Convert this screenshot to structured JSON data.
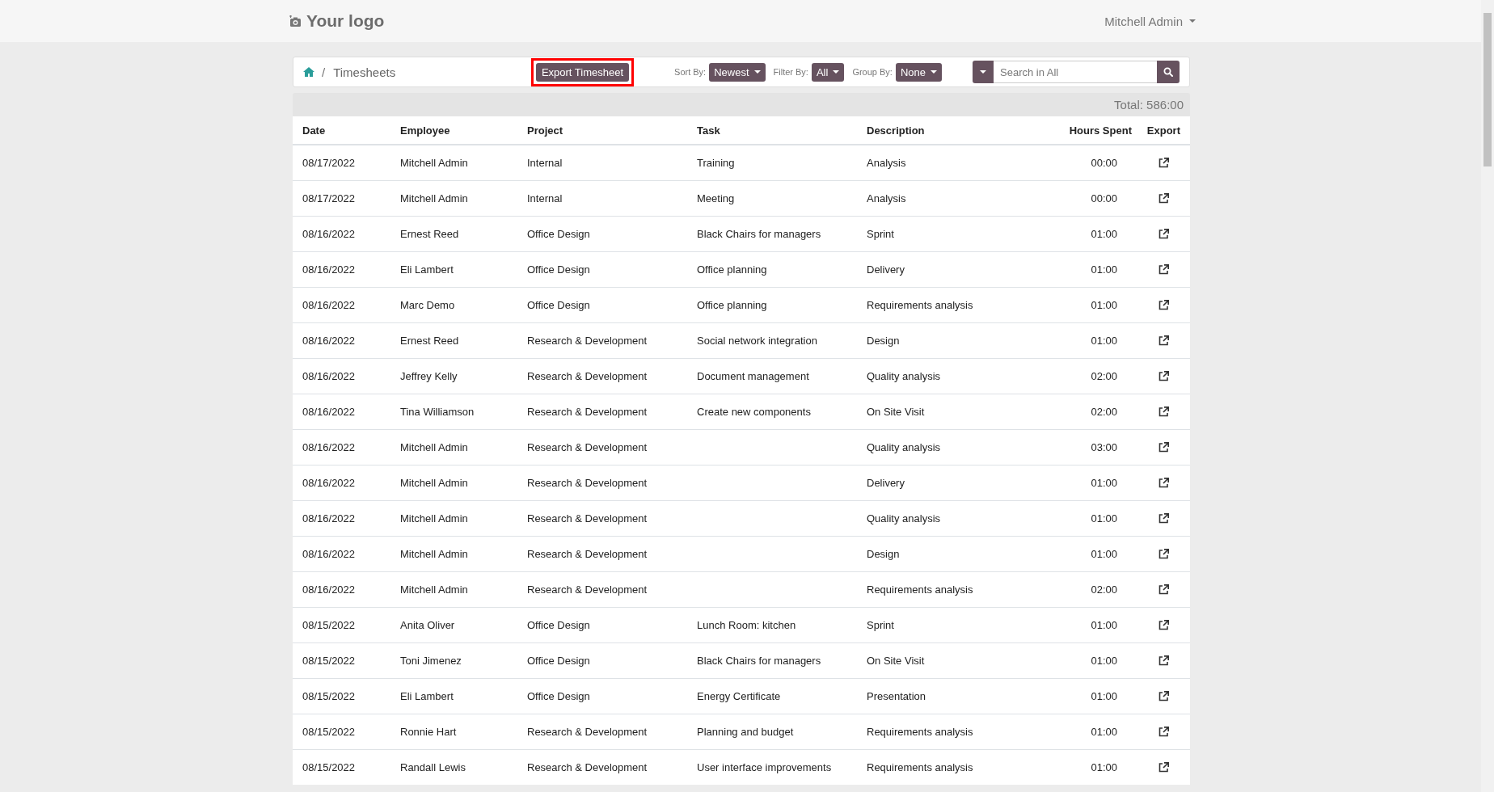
{
  "header": {
    "logo_text": "Your logo",
    "user": "Mitchell Admin"
  },
  "toolbar": {
    "breadcrumb_separator": "/",
    "breadcrumb": "Timesheets",
    "export_button": {
      "label": "Export Timesheet",
      "highlighted": true
    },
    "sort_by": {
      "label": "Sort By:",
      "value": "Newest"
    },
    "filter_by": {
      "label": "Filter By:",
      "value": "All"
    },
    "group_by": {
      "label": "Group By:",
      "value": "None"
    },
    "search": {
      "placeholder": "Search in All"
    }
  },
  "total": "Total: 586:00",
  "table": {
    "columns": [
      "Date",
      "Employee",
      "Project",
      "Task",
      "Description",
      "Hours Spent",
      "Export"
    ],
    "rows": [
      [
        "08/17/2022",
        "Mitchell Admin",
        "Internal",
        "Training",
        "Analysis",
        "00:00"
      ],
      [
        "08/17/2022",
        "Mitchell Admin",
        "Internal",
        "Meeting",
        "Analysis",
        "00:00"
      ],
      [
        "08/16/2022",
        "Ernest Reed",
        "Office Design",
        "Black Chairs for managers",
        "Sprint",
        "01:00"
      ],
      [
        "08/16/2022",
        "Eli Lambert",
        "Office Design",
        "Office planning",
        "Delivery",
        "01:00"
      ],
      [
        "08/16/2022",
        "Marc Demo",
        "Office Design",
        "Office planning",
        "Requirements analysis",
        "01:00"
      ],
      [
        "08/16/2022",
        "Ernest Reed",
        "Research & Development",
        "Social network integration",
        "Design",
        "01:00"
      ],
      [
        "08/16/2022",
        "Jeffrey Kelly",
        "Research & Development",
        "Document management",
        "Quality analysis",
        "02:00"
      ],
      [
        "08/16/2022",
        "Tina Williamson",
        "Research & Development",
        "Create new components",
        "On Site Visit",
        "02:00"
      ],
      [
        "08/16/2022",
        "Mitchell Admin",
        "Research & Development",
        "",
        "Quality analysis",
        "03:00"
      ],
      [
        "08/16/2022",
        "Mitchell Admin",
        "Research & Development",
        "",
        "Delivery",
        "01:00"
      ],
      [
        "08/16/2022",
        "Mitchell Admin",
        "Research & Development",
        "",
        "Quality analysis",
        "01:00"
      ],
      [
        "08/16/2022",
        "Mitchell Admin",
        "Research & Development",
        "",
        "Design",
        "01:00"
      ],
      [
        "08/16/2022",
        "Mitchell Admin",
        "Research & Development",
        "",
        "Requirements analysis",
        "02:00"
      ],
      [
        "08/15/2022",
        "Anita Oliver",
        "Office Design",
        "Lunch Room: kitchen",
        "Sprint",
        "01:00"
      ],
      [
        "08/15/2022",
        "Toni Jimenez",
        "Office Design",
        "Black Chairs for managers",
        "On Site Visit",
        "01:00"
      ],
      [
        "08/15/2022",
        "Eli Lambert",
        "Office Design",
        "Energy Certificate",
        "Presentation",
        "01:00"
      ],
      [
        "08/15/2022",
        "Ronnie Hart",
        "Research & Development",
        "Planning and budget",
        "Requirements analysis",
        "01:00"
      ],
      [
        "08/15/2022",
        "Randall Lewis",
        "Research & Development",
        "User interface improvements",
        "Requirements analysis",
        "01:00"
      ]
    ]
  }
}
